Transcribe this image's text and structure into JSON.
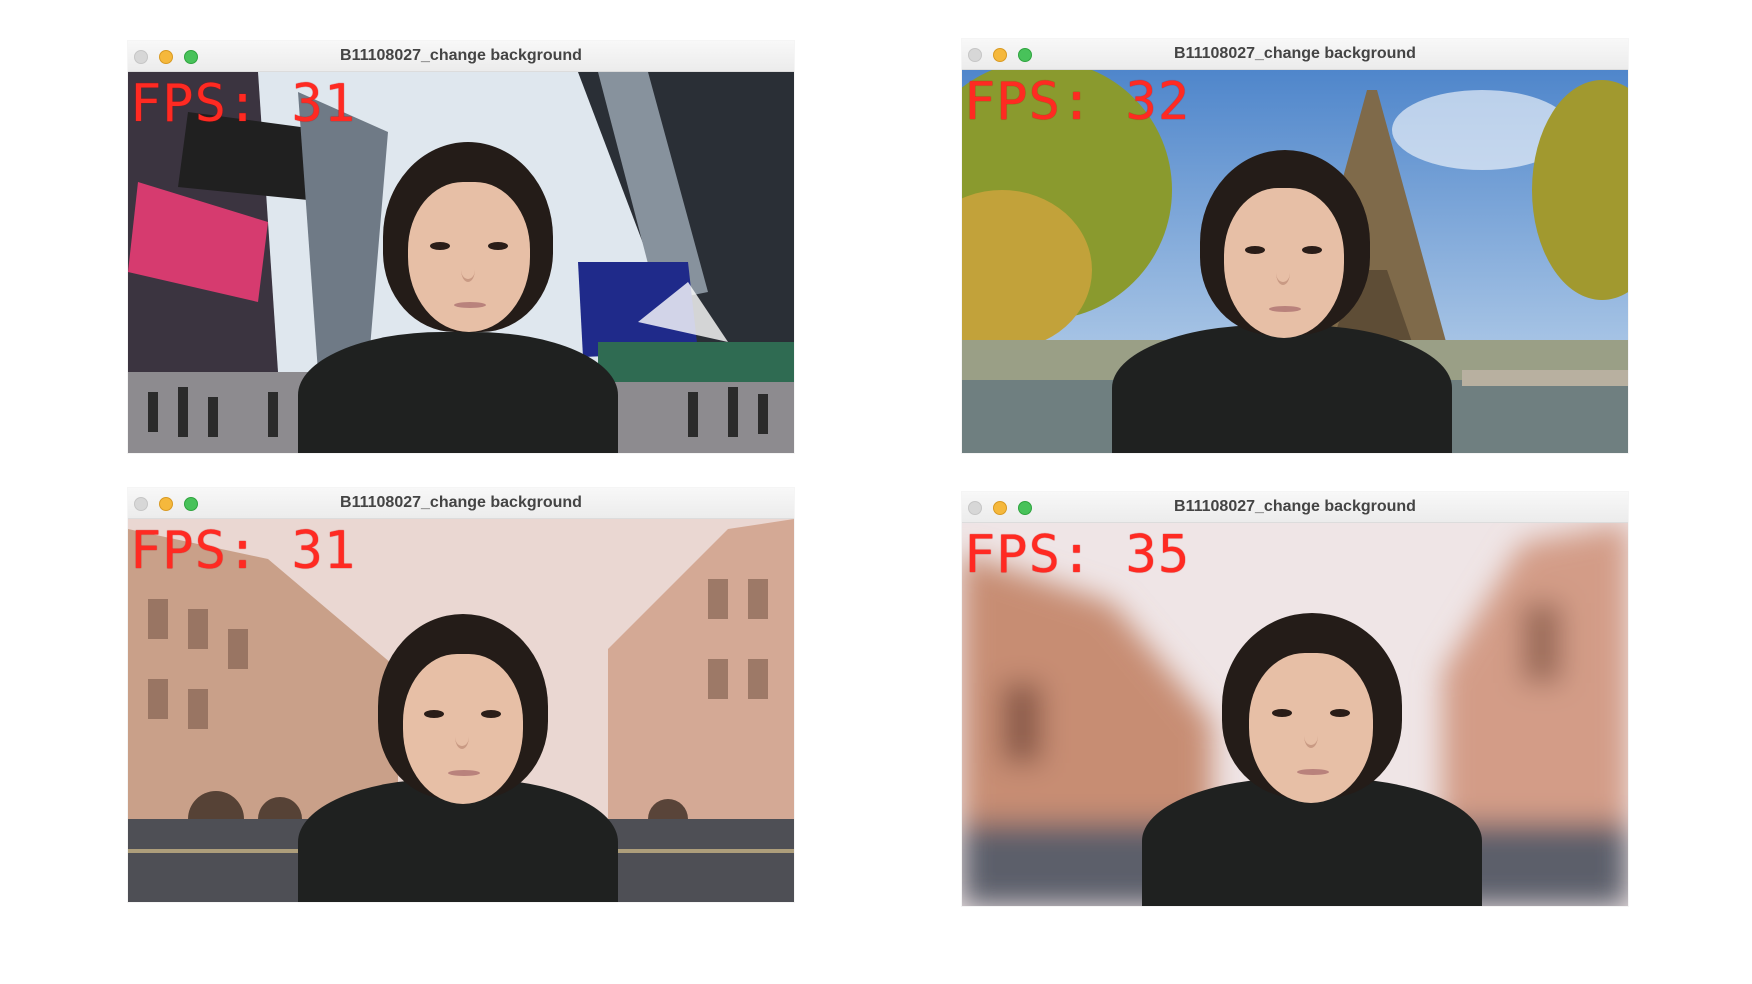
{
  "windows": [
    {
      "title": "B11108027_change background",
      "fps_label": "FPS: 31",
      "background_scene": "times-square",
      "colors": {
        "sky": "#dfe7ee",
        "accent": "#1f2a8a",
        "billboard": "#d63b6f"
      }
    },
    {
      "title": "B11108027_change background",
      "fps_label": "FPS: 32",
      "background_scene": "eiffel-tower",
      "colors": {
        "sky": "#5b8fd0",
        "accent": "#7f6a4a",
        "foliage": "#c2a23a"
      }
    },
    {
      "title": "B11108027_change background",
      "fps_label": "FPS: 31",
      "background_scene": "london-street",
      "colors": {
        "sky": "#ead7d2",
        "accent": "#c9a089",
        "road": "#4e4f55"
      }
    },
    {
      "title": "B11108027_change background",
      "fps_label": "FPS: 35",
      "background_scene": "blurred-street",
      "colors": {
        "sky": "#efe5e6",
        "accent": "#c78d73",
        "road": "#5c5f6b"
      }
    }
  ],
  "icons": {
    "close": "close-button-icon",
    "minimize": "minimize-button-icon",
    "zoom": "zoom-button-icon"
  },
  "fps_color": "#ff2a22"
}
